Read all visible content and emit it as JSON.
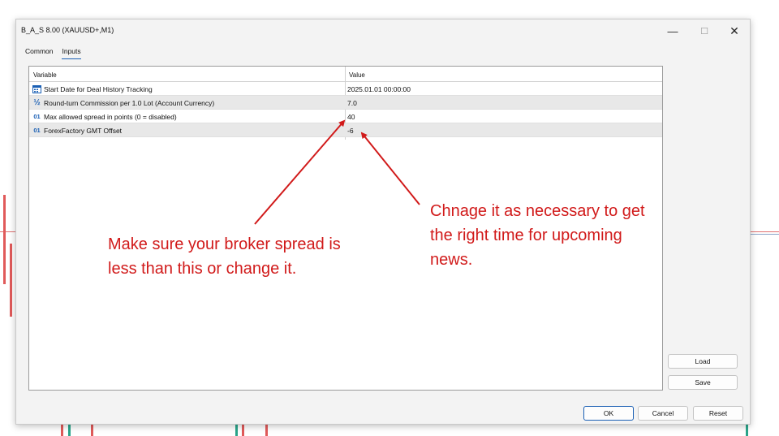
{
  "window": {
    "title": "B_A_S 8.00 (XAUUSD+,M1)",
    "controls": {
      "minimize": "—",
      "maximize": "☐",
      "close": "✕"
    }
  },
  "tabs": [
    {
      "label": "Common",
      "active": false
    },
    {
      "label": "Inputs",
      "active": true
    }
  ],
  "grid": {
    "columns": {
      "variable": "Variable",
      "value": "Value"
    },
    "rows": [
      {
        "icon": "calendar-icon",
        "name": "Start Date for Deal History Tracking",
        "value": "2025.01.01 00:00:00"
      },
      {
        "icon": "fraction-icon",
        "icon_text": "½",
        "name": "Round-turn Commission per 1.0 Lot (Account Currency)",
        "value": "7.0"
      },
      {
        "icon": "integer-icon",
        "icon_text": "01",
        "name": "Max allowed spread in points (0 = disabled)",
        "value": "40"
      },
      {
        "icon": "integer-icon",
        "icon_text": "01",
        "name": "ForexFactory GMT Offset",
        "value": "-6"
      }
    ]
  },
  "side_buttons": {
    "load": "Load",
    "save": "Save"
  },
  "footer_buttons": {
    "ok": "OK",
    "cancel": "Cancel",
    "reset": "Reset"
  },
  "annotations": {
    "left": "Make sure your broker spread is less than this or change it.",
    "right": "Chnage it as necessary to get the right time for upcoming news."
  },
  "colors": {
    "annotation": "#d11a1a",
    "accent": "#1a5fb4"
  }
}
